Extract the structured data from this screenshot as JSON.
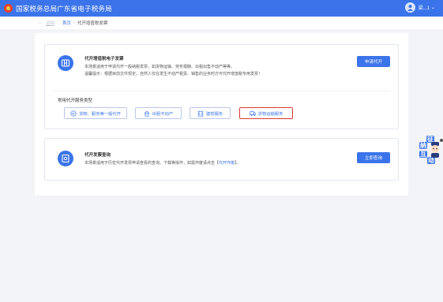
{
  "header": {
    "title": "国家税务总局广东省电子税务局",
    "user_name": "梁...1",
    "user_caret": "⌄"
  },
  "breadcrumb": {
    "back_arrow": "←",
    "back_label": "返回",
    "home": "首页",
    "separator": "›",
    "current": "代开增值税发票"
  },
  "card1": {
    "title": "代开增值税电子发票",
    "desc_line1": "本场景适用于申请代开一般纳税发票，如货物运输、劳务报酬、出租出售不动产等等。",
    "desc_line2": "温馨提示：根据目前文件规定，自然人仅在发生不动产租赁、销售的业务时方可代开增值税专用发票！",
    "apply_button": "申请代开",
    "section_label": "常用代开服务类型",
    "types": [
      {
        "label": "货物、服务等一般代开",
        "icon": "chat-icon"
      },
      {
        "label": "出租不动产",
        "icon": "house-icon"
      },
      {
        "label": "建筑服务",
        "icon": "building-icon"
      },
      {
        "label": "货物运输服务",
        "icon": "truck-icon"
      }
    ]
  },
  "card2": {
    "title": "代开发票查询",
    "desc_prefix": "本场景适用于历史代开发票申请查看的查询、下载等操作，如需作废请点击【",
    "desc_link": "代开作废",
    "desc_suffix": "】。",
    "query_button": "立即查询"
  },
  "floating": {
    "char1": "征",
    "char2": "纳",
    "char3": "互",
    "char4": "动"
  },
  "colors": {
    "brand": "#3b74ea",
    "selected_border": "#d93a31",
    "background": "#f2f4f7"
  }
}
